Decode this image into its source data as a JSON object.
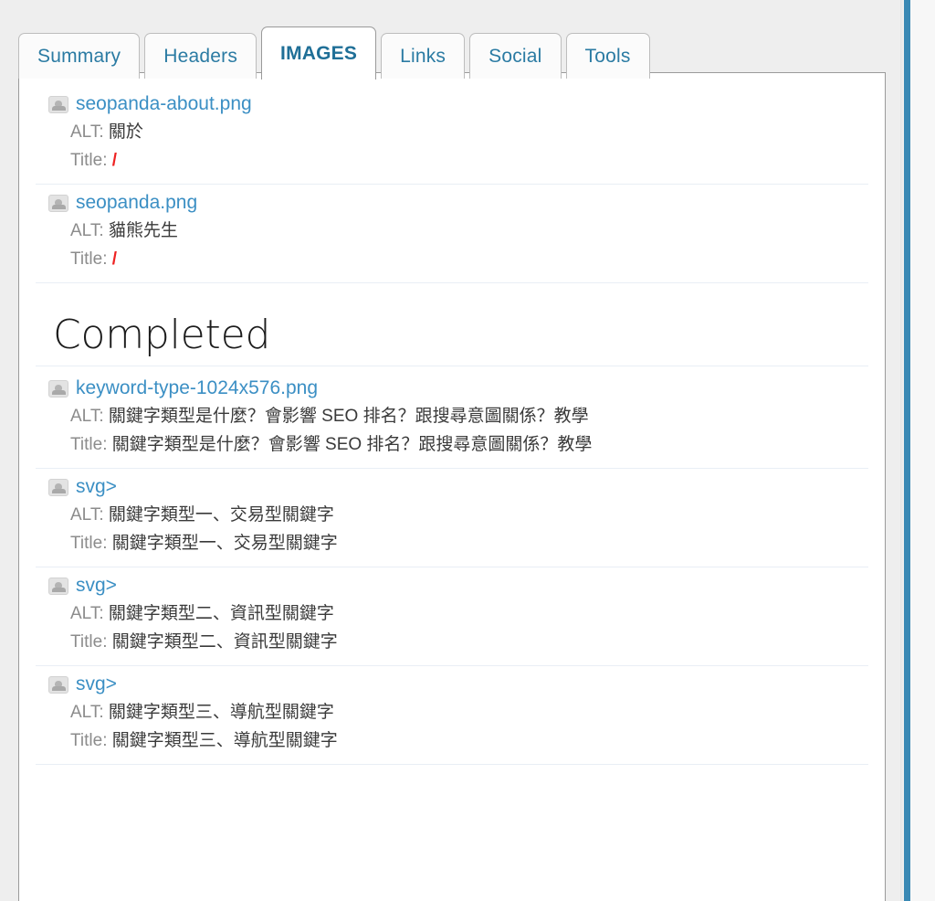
{
  "tabs": [
    {
      "label": "Summary",
      "active": false
    },
    {
      "label": "Headers",
      "active": false
    },
    {
      "label": "IMAGES",
      "active": true
    },
    {
      "label": "Links",
      "active": false
    },
    {
      "label": "Social",
      "active": false
    },
    {
      "label": "Tools",
      "active": false
    }
  ],
  "labels": {
    "alt": "ALT:",
    "title": "Title:",
    "empty_marker": "/"
  },
  "sections": [
    {
      "heading": null,
      "entries": [
        {
          "filename": "seopanda-about.png",
          "icon": "broken-image-icon",
          "alt": "關於",
          "title": "/",
          "title_empty": true
        },
        {
          "filename": "seopanda.png",
          "icon": "broken-image-icon",
          "alt": "貓熊先生",
          "title": "/",
          "title_empty": true
        }
      ]
    },
    {
      "heading": "Completed",
      "entries": [
        {
          "filename": "keyword-type-1024x576.png",
          "icon": "broken-image-icon",
          "alt": "關鍵字類型是什麼？會影響 SEO 排名？跟搜尋意圖關係？教學",
          "title": "關鍵字類型是什麼？會影響 SEO 排名？跟搜尋意圖關係？教學",
          "title_empty": false
        },
        {
          "filename": "svg>",
          "icon": "broken-image-icon",
          "alt": "關鍵字類型一、交易型關鍵字",
          "title": "關鍵字類型一、交易型關鍵字",
          "title_empty": false
        },
        {
          "filename": "svg>",
          "icon": "broken-image-icon",
          "alt": "關鍵字類型二、資訊型關鍵字",
          "title": "關鍵字類型二、資訊型關鍵字",
          "title_empty": false
        },
        {
          "filename": "svg>",
          "icon": "broken-image-icon",
          "alt": "關鍵字類型三、導航型關鍵字",
          "title": "關鍵字類型三、導航型關鍵字",
          "title_empty": false
        }
      ]
    }
  ],
  "colors": {
    "tab_link": "#2b7ba3",
    "filename_link": "#3b8fc4",
    "empty_value": "#ee2222",
    "rail": "#3a89b4",
    "divider": "#e9eef5"
  }
}
